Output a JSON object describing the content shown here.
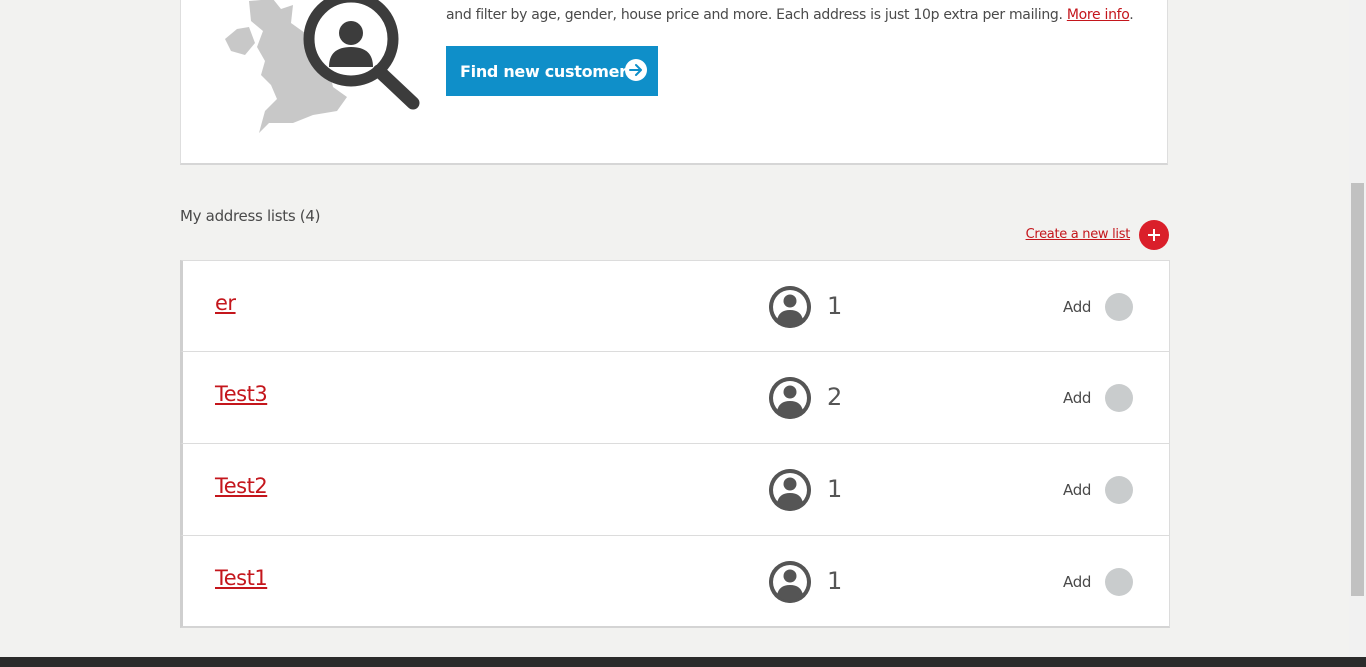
{
  "promo": {
    "text": "and filter by age, gender, house price and more. Each address is just 10p extra per mailing.",
    "more_info": "More info",
    "period": ".",
    "button_label": "Find new customers"
  },
  "lists": {
    "heading": "My address lists (4)",
    "create_label": "Create a new list",
    "add_label": "Add",
    "rows": [
      {
        "name": "er",
        "count": "1"
      },
      {
        "name": "Test3",
        "count": "2"
      },
      {
        "name": "Test2",
        "count": "1"
      },
      {
        "name": "Test1",
        "count": "1"
      }
    ]
  },
  "colors": {
    "accent_red": "#c4161c",
    "button_blue": "#0f8fc9"
  }
}
